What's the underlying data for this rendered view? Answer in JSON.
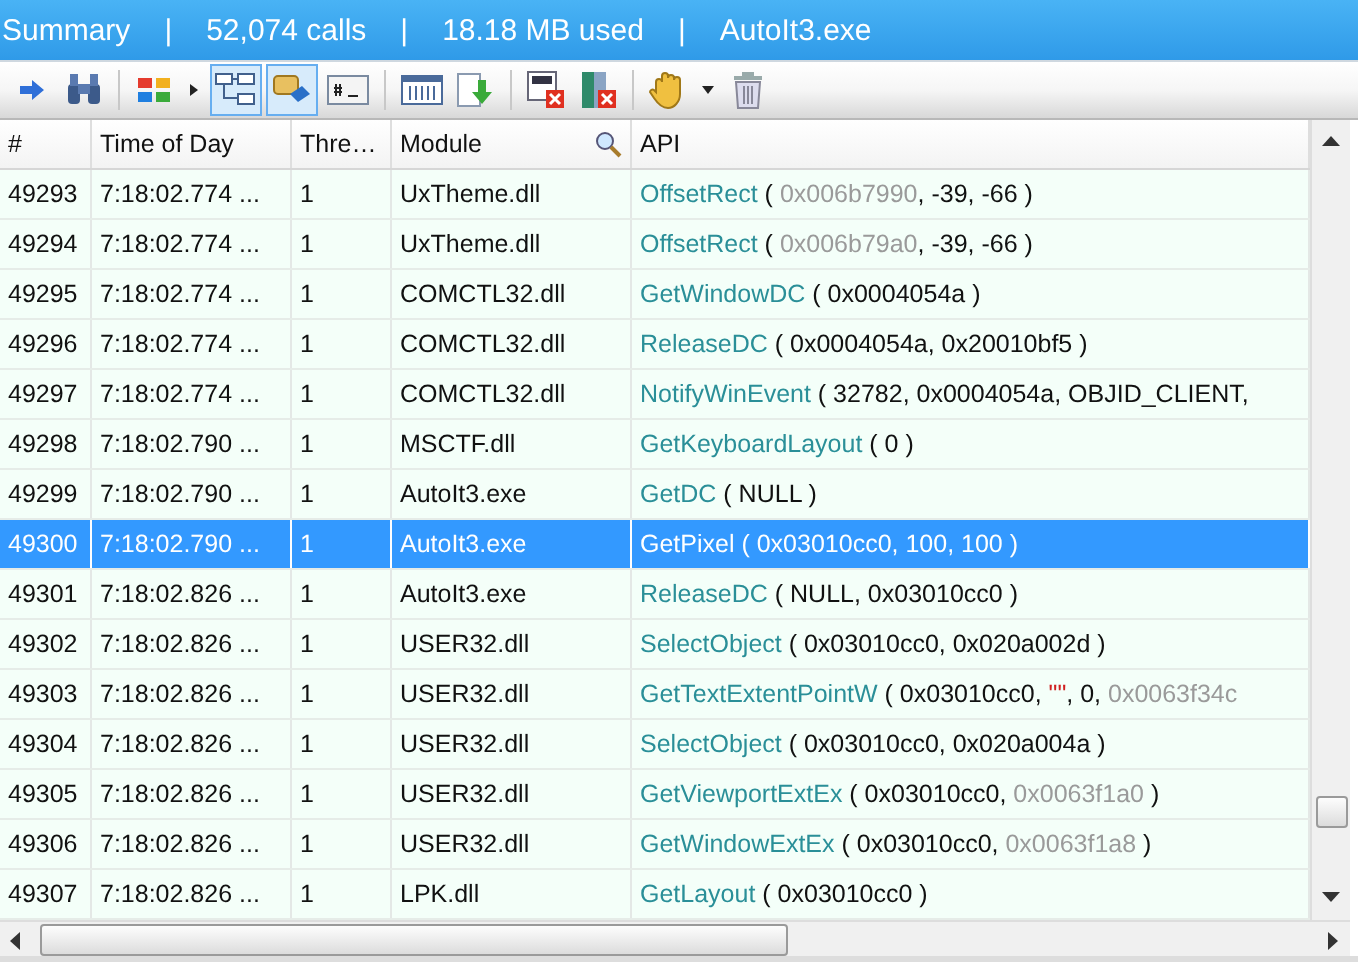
{
  "summary_bar": [
    {
      "text": "Summary",
      "kind": "label"
    },
    {
      "text": "|",
      "kind": "separator"
    },
    {
      "text": "52,074 calls",
      "kind": "label"
    },
    {
      "text": "|",
      "kind": "separator"
    },
    {
      "text": "18.18 MB used",
      "kind": "label"
    },
    {
      "text": "|",
      "kind": "separator"
    },
    {
      "text": "AutoIt3.exe",
      "kind": "label"
    }
  ],
  "toolbar": [
    {
      "kind": "button",
      "selected": false
    },
    {
      "kind": "button",
      "selected": false
    },
    {
      "kind": "separator"
    },
    {
      "kind": "button",
      "selected": false
    },
    {
      "kind": "dropdown"
    },
    {
      "kind": "button",
      "selected": true
    },
    {
      "kind": "button",
      "selected": true
    },
    {
      "kind": "button",
      "selected": false
    },
    {
      "kind": "separator"
    },
    {
      "kind": "button",
      "selected": false
    },
    {
      "kind": "button",
      "selected": false
    },
    {
      "kind": "separator"
    },
    {
      "kind": "button",
      "selected": false
    },
    {
      "kind": "button",
      "selected": false
    },
    {
      "kind": "separator"
    },
    {
      "kind": "button",
      "selected": false
    },
    {
      "kind": "dropdown"
    },
    {
      "kind": "button",
      "selected": false
    }
  ],
  "table": {
    "columns": [
      {
        "label": "#",
        "search": false
      },
      {
        "label": "Time of Day",
        "search": false
      },
      {
        "label": "Thre…",
        "search": false
      },
      {
        "label": "Module",
        "search": true
      },
      {
        "label": "API",
        "search": false
      }
    ],
    "rows": [
      {
        "index": "49293",
        "time": "7:18:02.774 ...",
        "thread": "1",
        "module": "UxTheme.dll",
        "selected": false,
        "api": [
          {
            "text": "OffsetRect",
            "kind": "func"
          },
          {
            "text": " ( ",
            "kind": "plain"
          },
          {
            "text": "0x006b7990",
            "kind": "pointer"
          },
          {
            "text": ", -39, -66 )",
            "kind": "plain"
          }
        ]
      },
      {
        "index": "49294",
        "time": "7:18:02.774 ...",
        "thread": "1",
        "module": "UxTheme.dll",
        "selected": false,
        "api": [
          {
            "text": "OffsetRect",
            "kind": "func"
          },
          {
            "text": " ( ",
            "kind": "plain"
          },
          {
            "text": "0x006b79a0",
            "kind": "pointer"
          },
          {
            "text": ", -39, -66 )",
            "kind": "plain"
          }
        ]
      },
      {
        "index": "49295",
        "time": "7:18:02.774 ...",
        "thread": "1",
        "module": "COMCTL32.dll",
        "selected": false,
        "api": [
          {
            "text": "GetWindowDC",
            "kind": "func"
          },
          {
            "text": " ( 0x0004054a )",
            "kind": "plain"
          }
        ]
      },
      {
        "index": "49296",
        "time": "7:18:02.774 ...",
        "thread": "1",
        "module": "COMCTL32.dll",
        "selected": false,
        "api": [
          {
            "text": "ReleaseDC",
            "kind": "func"
          },
          {
            "text": " ( 0x0004054a, 0x20010bf5 )",
            "kind": "plain"
          }
        ]
      },
      {
        "index": "49297",
        "time": "7:18:02.774 ...",
        "thread": "1",
        "module": "COMCTL32.dll",
        "selected": false,
        "api": [
          {
            "text": "NotifyWinEvent",
            "kind": "func"
          },
          {
            "text": " ( 32782, 0x0004054a, OBJID_CLIENT,",
            "kind": "plain"
          }
        ]
      },
      {
        "index": "49298",
        "time": "7:18:02.790 ...",
        "thread": "1",
        "module": "MSCTF.dll",
        "selected": false,
        "api": [
          {
            "text": "GetKeyboardLayout",
            "kind": "func"
          },
          {
            "text": " ( 0 )",
            "kind": "plain"
          }
        ]
      },
      {
        "index": "49299",
        "time": "7:18:02.790 ...",
        "thread": "1",
        "module": "AutoIt3.exe",
        "selected": false,
        "api": [
          {
            "text": "GetDC",
            "kind": "func"
          },
          {
            "text": " ( NULL )",
            "kind": "plain"
          }
        ]
      },
      {
        "index": "49300",
        "time": "7:18:02.790 ...",
        "thread": "1",
        "module": "AutoIt3.exe",
        "selected": true,
        "api": [
          {
            "text": "GetPixel",
            "kind": "func"
          },
          {
            "text": " ( 0x03010cc0, 100, 100 )",
            "kind": "plain"
          }
        ]
      },
      {
        "index": "49301",
        "time": "7:18:02.826 ...",
        "thread": "1",
        "module": "AutoIt3.exe",
        "selected": false,
        "api": [
          {
            "text": "ReleaseDC",
            "kind": "func"
          },
          {
            "text": " ( NULL, 0x03010cc0 )",
            "kind": "plain"
          }
        ]
      },
      {
        "index": "49302",
        "time": "7:18:02.826 ...",
        "thread": "1",
        "module": "USER32.dll",
        "selected": false,
        "api": [
          {
            "text": "SelectObject",
            "kind": "func"
          },
          {
            "text": " ( 0x03010cc0, 0x020a002d )",
            "kind": "plain"
          }
        ]
      },
      {
        "index": "49303",
        "time": "7:18:02.826 ...",
        "thread": "1",
        "module": "USER32.dll",
        "selected": false,
        "api": [
          {
            "text": "GetTextExtentPointW",
            "kind": "func"
          },
          {
            "text": " ( 0x03010cc0, ",
            "kind": "plain"
          },
          {
            "text": "\"\"",
            "kind": "string"
          },
          {
            "text": ", 0, ",
            "kind": "plain"
          },
          {
            "text": "0x0063f34c",
            "kind": "pointer"
          }
        ]
      },
      {
        "index": "49304",
        "time": "7:18:02.826 ...",
        "thread": "1",
        "module": "USER32.dll",
        "selected": false,
        "api": [
          {
            "text": "SelectObject",
            "kind": "func"
          },
          {
            "text": " ( 0x03010cc0, 0x020a004a )",
            "kind": "plain"
          }
        ]
      },
      {
        "index": "49305",
        "time": "7:18:02.826 ...",
        "thread": "1",
        "module": "USER32.dll",
        "selected": false,
        "api": [
          {
            "text": "GetViewportExtEx",
            "kind": "func"
          },
          {
            "text": " ( 0x03010cc0, ",
            "kind": "plain"
          },
          {
            "text": "0x0063f1a0",
            "kind": "pointer"
          },
          {
            "text": " )",
            "kind": "plain"
          }
        ]
      },
      {
        "index": "49306",
        "time": "7:18:02.826 ...",
        "thread": "1",
        "module": "USER32.dll",
        "selected": false,
        "api": [
          {
            "text": "GetWindowExtEx",
            "kind": "func"
          },
          {
            "text": " ( 0x03010cc0, ",
            "kind": "plain"
          },
          {
            "text": "0x0063f1a8",
            "kind": "pointer"
          },
          {
            "text": " )",
            "kind": "plain"
          }
        ]
      },
      {
        "index": "49307",
        "time": "7:18:02.826 ...",
        "thread": "1",
        "module": "LPK.dll",
        "selected": false,
        "api": [
          {
            "text": "GetLayout",
            "kind": "func"
          },
          {
            "text": " ( 0x03010cc0 )",
            "kind": "plain"
          }
        ]
      }
    ]
  }
}
